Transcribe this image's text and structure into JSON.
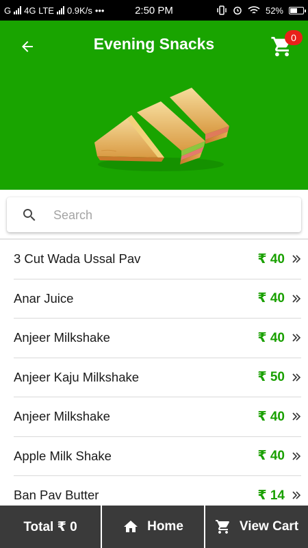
{
  "status_bar": {
    "carrier": "G",
    "network": "4G LTE",
    "speed": "0.9K/s",
    "dots": "•••",
    "time": "2:50 PM",
    "battery": "52%"
  },
  "header": {
    "title": "Evening Snacks",
    "cart_count": "0",
    "accent_color": "#19a400"
  },
  "search": {
    "placeholder": "Search",
    "value": ""
  },
  "items": [
    {
      "name": "3 Cut Wada Ussal Pav",
      "price": "₹ 40"
    },
    {
      "name": "Anar Juice",
      "price": "₹ 40"
    },
    {
      "name": "Anjeer Milkshake",
      "price": "₹ 40"
    },
    {
      "name": "Anjeer Kaju Milkshake",
      "price": "₹ 50"
    },
    {
      "name": "Anjeer Milkshake",
      "price": "₹ 40"
    },
    {
      "name": "Apple Milk Shake",
      "price": "₹ 40"
    },
    {
      "name": "Ban Pav Butter",
      "price": "₹ 14"
    }
  ],
  "bottom_bar": {
    "total_label": "Total ₹ 0",
    "home_label": "Home",
    "cart_label": "View Cart"
  },
  "icons": {
    "back": "arrow-back-icon",
    "cart": "shopping-cart-icon",
    "search": "search-icon",
    "chevron": "double-chevron-right-icon",
    "home": "home-icon"
  }
}
